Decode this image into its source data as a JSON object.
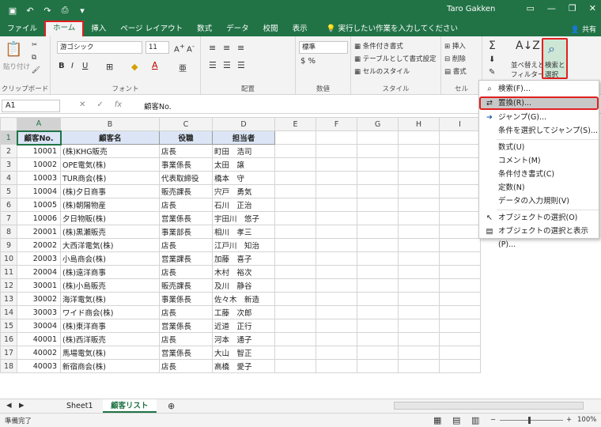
{
  "title": {
    "user": "Taro Gakken"
  },
  "tabs": [
    "ファイル",
    "ホーム",
    "挿入",
    "ページ レイアウト",
    "数式",
    "データ",
    "校閲",
    "表示"
  ],
  "tellme": "実行したい作業を入力してください",
  "share": "共有",
  "ribbon": {
    "clipboard": {
      "paste": "貼り付け",
      "label": "クリップボード"
    },
    "font": {
      "name": "游ゴシック",
      "size": "11",
      "label": "フォント"
    },
    "align": {
      "label": "配置"
    },
    "number": {
      "format": "標準",
      "label": "数値"
    },
    "style": {
      "cond": "条件付き書式",
      "table": "テーブルとして書式設定",
      "cell": "セルのスタイル",
      "label": "スタイル"
    },
    "cells": {
      "insert": "挿入",
      "delete": "削除",
      "format": "書式",
      "label": "セル"
    },
    "edit": {
      "sort1": "並べ替えと",
      "sort2": "フィルター",
      "find1": "検索と",
      "find2": "選択"
    }
  },
  "formula": {
    "cell": "A1",
    "value": "顧客No."
  },
  "columns": [
    "A",
    "B",
    "C",
    "D",
    "E",
    "F",
    "G",
    "H",
    "I"
  ],
  "headers": [
    "顧客No.",
    "顧客名",
    "役職",
    "担当者"
  ],
  "rows": [
    [
      "10001",
      "(株)KHG販売",
      "店長",
      "町田　浩司"
    ],
    [
      "10002",
      "OPE電気(株)",
      "事業係長",
      "太田　譲"
    ],
    [
      "10003",
      "TUR商会(株)",
      "代表取締役",
      "橋本　守"
    ],
    [
      "10004",
      "(株)夕日商事",
      "販売課長",
      "宍戸　勇気"
    ],
    [
      "10005",
      "(株)朝陽物産",
      "店長",
      "石川　正治"
    ],
    [
      "10006",
      "夕日物販(株)",
      "営業係長",
      "宇田川　悠子"
    ],
    [
      "20001",
      "(株)黒瀬販売",
      "事業部長",
      "相川　孝三"
    ],
    [
      "20002",
      "大西洋電気(株)",
      "店長",
      "江戸川　知治"
    ],
    [
      "20003",
      "小島商会(株)",
      "営業課長",
      "加藤　喜子"
    ],
    [
      "20004",
      "(株)遠洋商事",
      "店長",
      "木村　裕次"
    ],
    [
      "30001",
      "(株)小島販売",
      "販売課長",
      "及川　静谷"
    ],
    [
      "30002",
      "海洋電気(株)",
      "事業係長",
      "佐々木　新造"
    ],
    [
      "30003",
      "ワイド商会(株)",
      "店長",
      "工藤　次郎"
    ],
    [
      "30004",
      "(株)東洋商事",
      "営業係長",
      "近道　正行"
    ],
    [
      "40001",
      "(株)西洋販売",
      "店長",
      "河本　通子"
    ],
    [
      "40002",
      "馬場電気(株)",
      "営業係長",
      "大山　智正"
    ],
    [
      "40003",
      "新宿商会(株)",
      "店長",
      "高橋　愛子"
    ]
  ],
  "sheets": [
    "Sheet1",
    "顧客リスト"
  ],
  "status": {
    "ready": "準備完了",
    "zoom": "100%"
  },
  "menu": {
    "items": [
      "検索(F)...",
      "置換(R)...",
      "ジャンプ(G)...",
      "条件を選択してジャンプ(S)...",
      "数式(U)",
      "コメント(M)",
      "条件付き書式(C)",
      "定数(N)",
      "データの入力規則(V)",
      "オブジェクトの選択(O)",
      "オブジェクトの選択と表示(P)..."
    ]
  },
  "colors": {
    "excel_green": "#217346",
    "highlight_red": "#e02020",
    "header_blue": "#dbe5f5"
  }
}
